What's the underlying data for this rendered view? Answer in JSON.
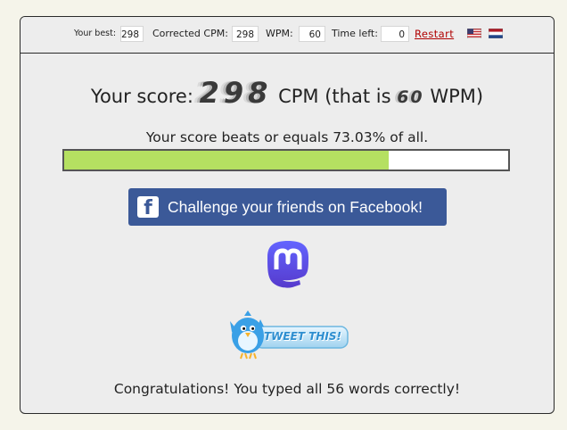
{
  "topbar": {
    "best_label": "Your best:",
    "best_value": "298",
    "corrected_label": "Corrected CPM:",
    "corrected_value": "298",
    "wpm_label": "WPM:",
    "wpm_value": "60",
    "time_label": "Time left:",
    "time_value": "0",
    "restart_label": "Restart",
    "flags": [
      "us-flag-icon",
      "netherlands-flag-icon"
    ]
  },
  "score": {
    "prefix": "Your score:",
    "cpm": "298",
    "cpm_unit": "CPM (that is",
    "wpm": "60",
    "wpm_unit": "WPM)"
  },
  "beats": {
    "text": "Your score beats or equals 73.03% of all.",
    "percent": 73.03
  },
  "share": {
    "facebook_label": "Challenge your friends on Facebook!",
    "tweet_label": "TWEET THIS!"
  },
  "congrats": "Congratulations! You typed all 56 words correctly!",
  "colors": {
    "progress_fill": "#b5e061",
    "facebook_blue": "#3b5998",
    "mastodon_purple": "#6364ff",
    "restart_red": "#b00000"
  }
}
